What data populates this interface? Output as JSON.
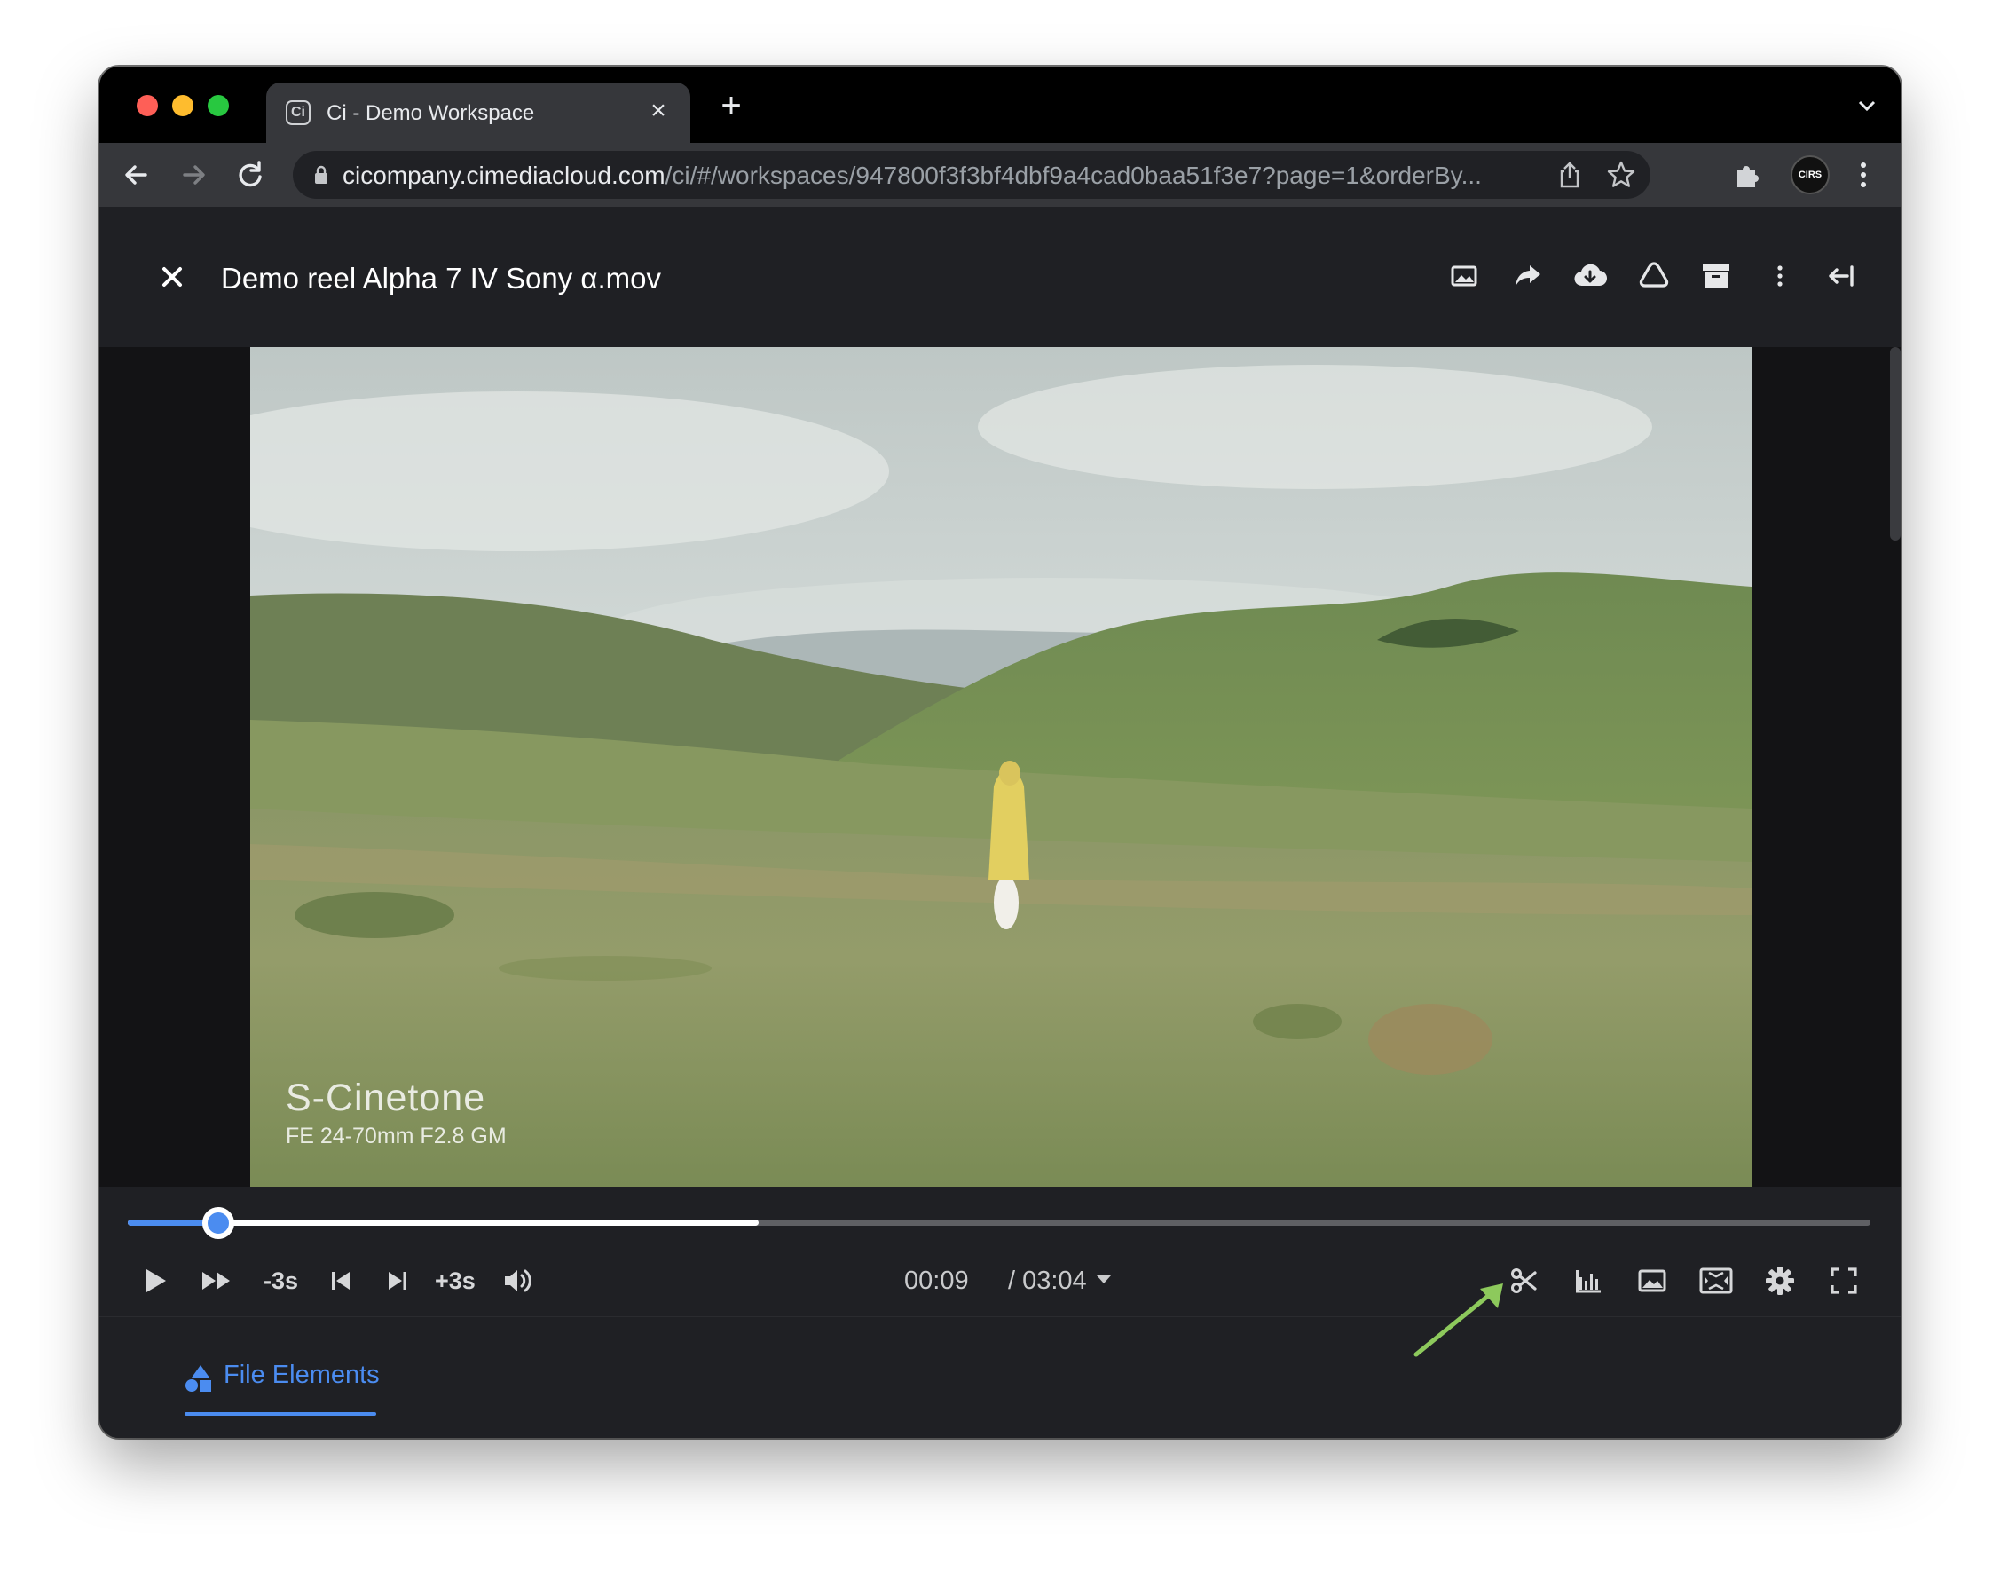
{
  "browser": {
    "tab_title": "Ci - Demo Workspace",
    "favicon_letter": "Ci",
    "url_host": "cicompany.cimediacloud.com",
    "url_path": "/ci/#/workspaces/947800f3f3bf4dbf9a4cad0baa51f3e7?page=1&orderBy...",
    "profile_text": "CIRS"
  },
  "header": {
    "file_title": "Demo reel Alpha 7 IV Sony α.mov",
    "actions": [
      "image-icon",
      "share-icon",
      "cloud-download-icon",
      "drive-icon",
      "archive-icon",
      "more-vert-icon",
      "collapse-panel-icon"
    ]
  },
  "video": {
    "caption_main": "S-Cinetone",
    "caption_sub": "FE 24-70mm F2.8 GM"
  },
  "player": {
    "progress_fraction": 0.052,
    "buffered_fraction": 0.362,
    "rewind_label": "-3s",
    "forward_label": "+3s",
    "current_time": "00:09",
    "total_time": "/ 03:04",
    "accent_color": "#4b8cf0"
  },
  "panel": {
    "tab_label": "File Elements"
  },
  "annotation_color": "#8dc95c"
}
